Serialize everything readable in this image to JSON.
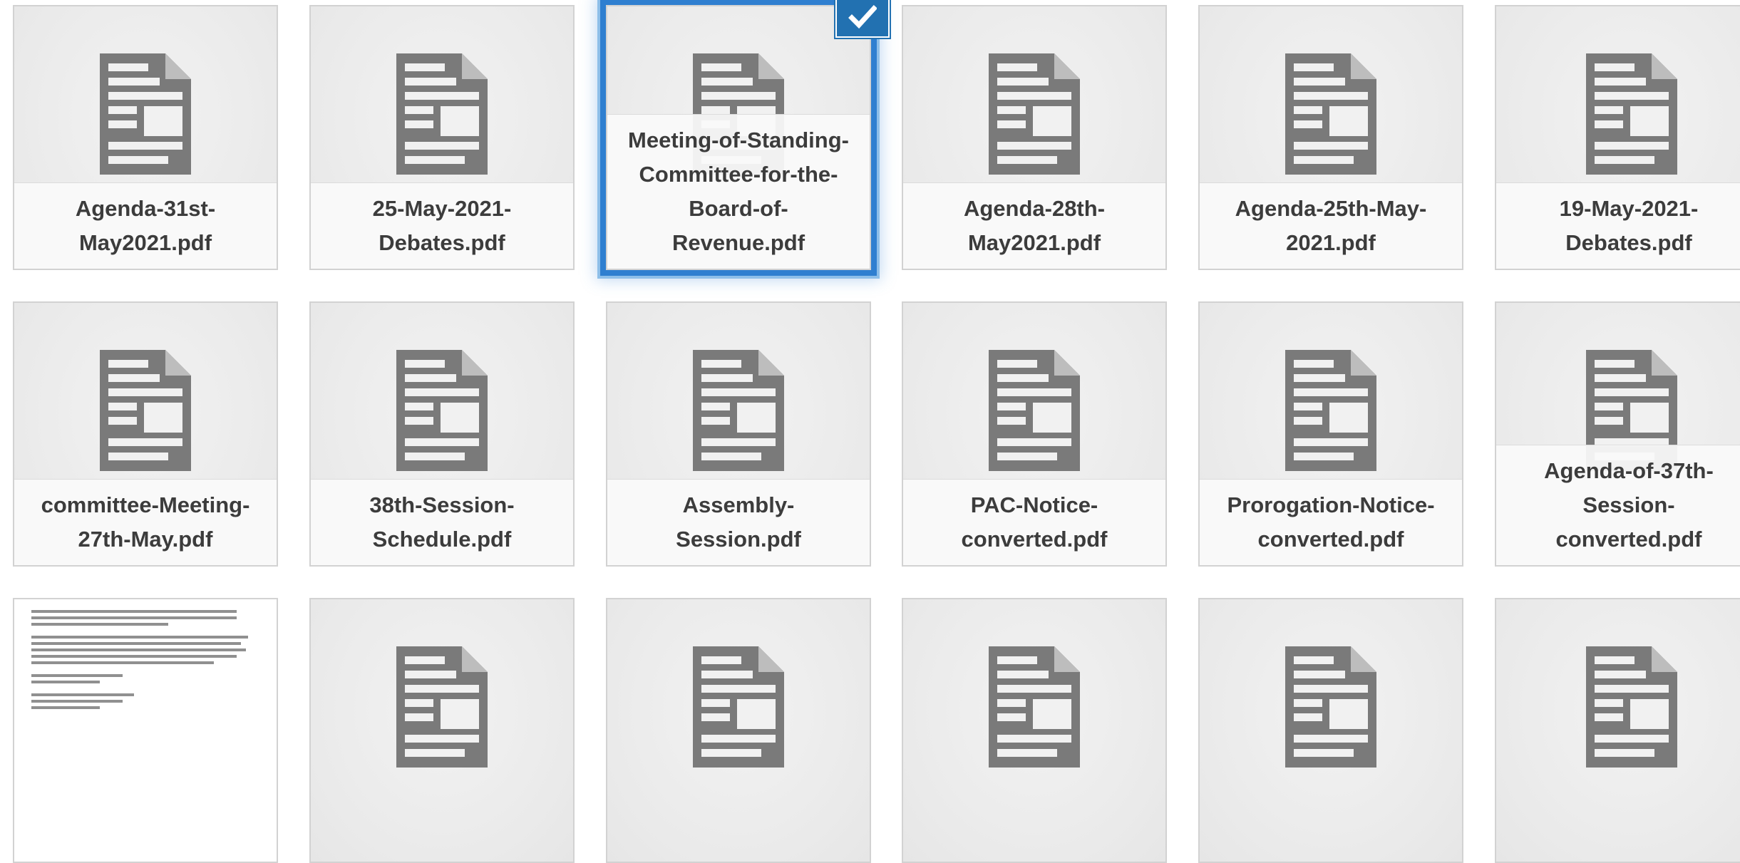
{
  "icons": {
    "document": "document-icon",
    "check": "checkmark-icon"
  },
  "colors": {
    "accent": "#2271b1",
    "selection_glow": "#8ebfe9",
    "tile_bg": "#eeeeee",
    "icon_gray": "#7a7a7a"
  },
  "rows": [
    {
      "files": [
        {
          "name": "Agenda-31st-May2021.pdf",
          "selected": false
        },
        {
          "name": "25-May-2021-Debates.pdf",
          "selected": false
        },
        {
          "name": "Meeting-of-Standing-Committee-for-the-Board-of-Revenue.pdf",
          "selected": true
        },
        {
          "name": "Agenda-28th-May2021.pdf",
          "selected": false
        },
        {
          "name": "Agenda-25th-May-2021.pdf",
          "selected": false
        },
        {
          "name": "19-May-2021-Debates.pdf",
          "selected": false
        }
      ]
    },
    {
      "files": [
        {
          "name": "committee-Meeting-27th-May.pdf",
          "selected": false
        },
        {
          "name": "38th-Session-Schedule.pdf",
          "selected": false
        },
        {
          "name": "Assembly-Session.pdf",
          "selected": false
        },
        {
          "name": "PAC-Notice-converted.pdf",
          "selected": false
        },
        {
          "name": "Prorogation-Notice-converted.pdf",
          "selected": false
        },
        {
          "name": "Agenda-of-37th-Session-converted.pdf",
          "selected": false
        }
      ]
    },
    {
      "files": [
        {
          "name": "",
          "selected": false,
          "thumbnail": true
        },
        {
          "name": "",
          "selected": false
        },
        {
          "name": "",
          "selected": false
        },
        {
          "name": "",
          "selected": false
        },
        {
          "name": "",
          "selected": false
        },
        {
          "name": "",
          "selected": false
        }
      ]
    }
  ]
}
